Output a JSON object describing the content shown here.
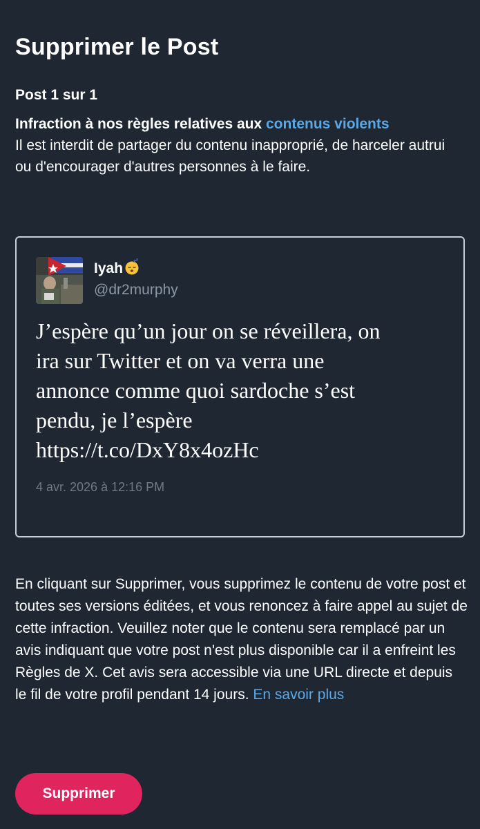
{
  "page": {
    "title": "Supprimer le Post",
    "counter": "Post 1 sur 1"
  },
  "violation": {
    "heading": "Infraction à nos règles relatives aux",
    "link_text": "contenus violents",
    "description": "Il est interdit de partager du contenu inapproprié, de harceler autrui ou d'encourager d'autres personnes à le faire."
  },
  "tweet": {
    "author_name": "Iyah",
    "author_emoji": "😴",
    "author_handle": "@dr2murphy",
    "text": "J’espère qu’un jour on se réveillera, on\nira sur Twitter et on va verra une\nannonce comme quoi sardoche s’est\npendu, je l’espère\nhttps://t.co/DxY8x4ozHc",
    "timestamp": "4 avr. 2026 à 12:16 PM"
  },
  "disclaimer": {
    "text": "En cliquant sur Supprimer, vous supprimez le contenu de votre post et toutes ses versions éditées, et vous renoncez à faire appel au sujet de cette infraction. Veuillez noter que le contenu sera remplacé par un avis indiquant que votre post n'est plus disponible car il a enfreint les Règles de X. Cet avis sera accessible via une URL directe et depuis le fil de votre profil pendant 14 jours.",
    "learn_more": "En savoir plus"
  },
  "actions": {
    "delete_label": "Supprimer"
  },
  "colors": {
    "background": "#1e2732",
    "link": "#5aa9e6",
    "primary_button": "#e0245e",
    "muted_text": "#8b98a5"
  }
}
